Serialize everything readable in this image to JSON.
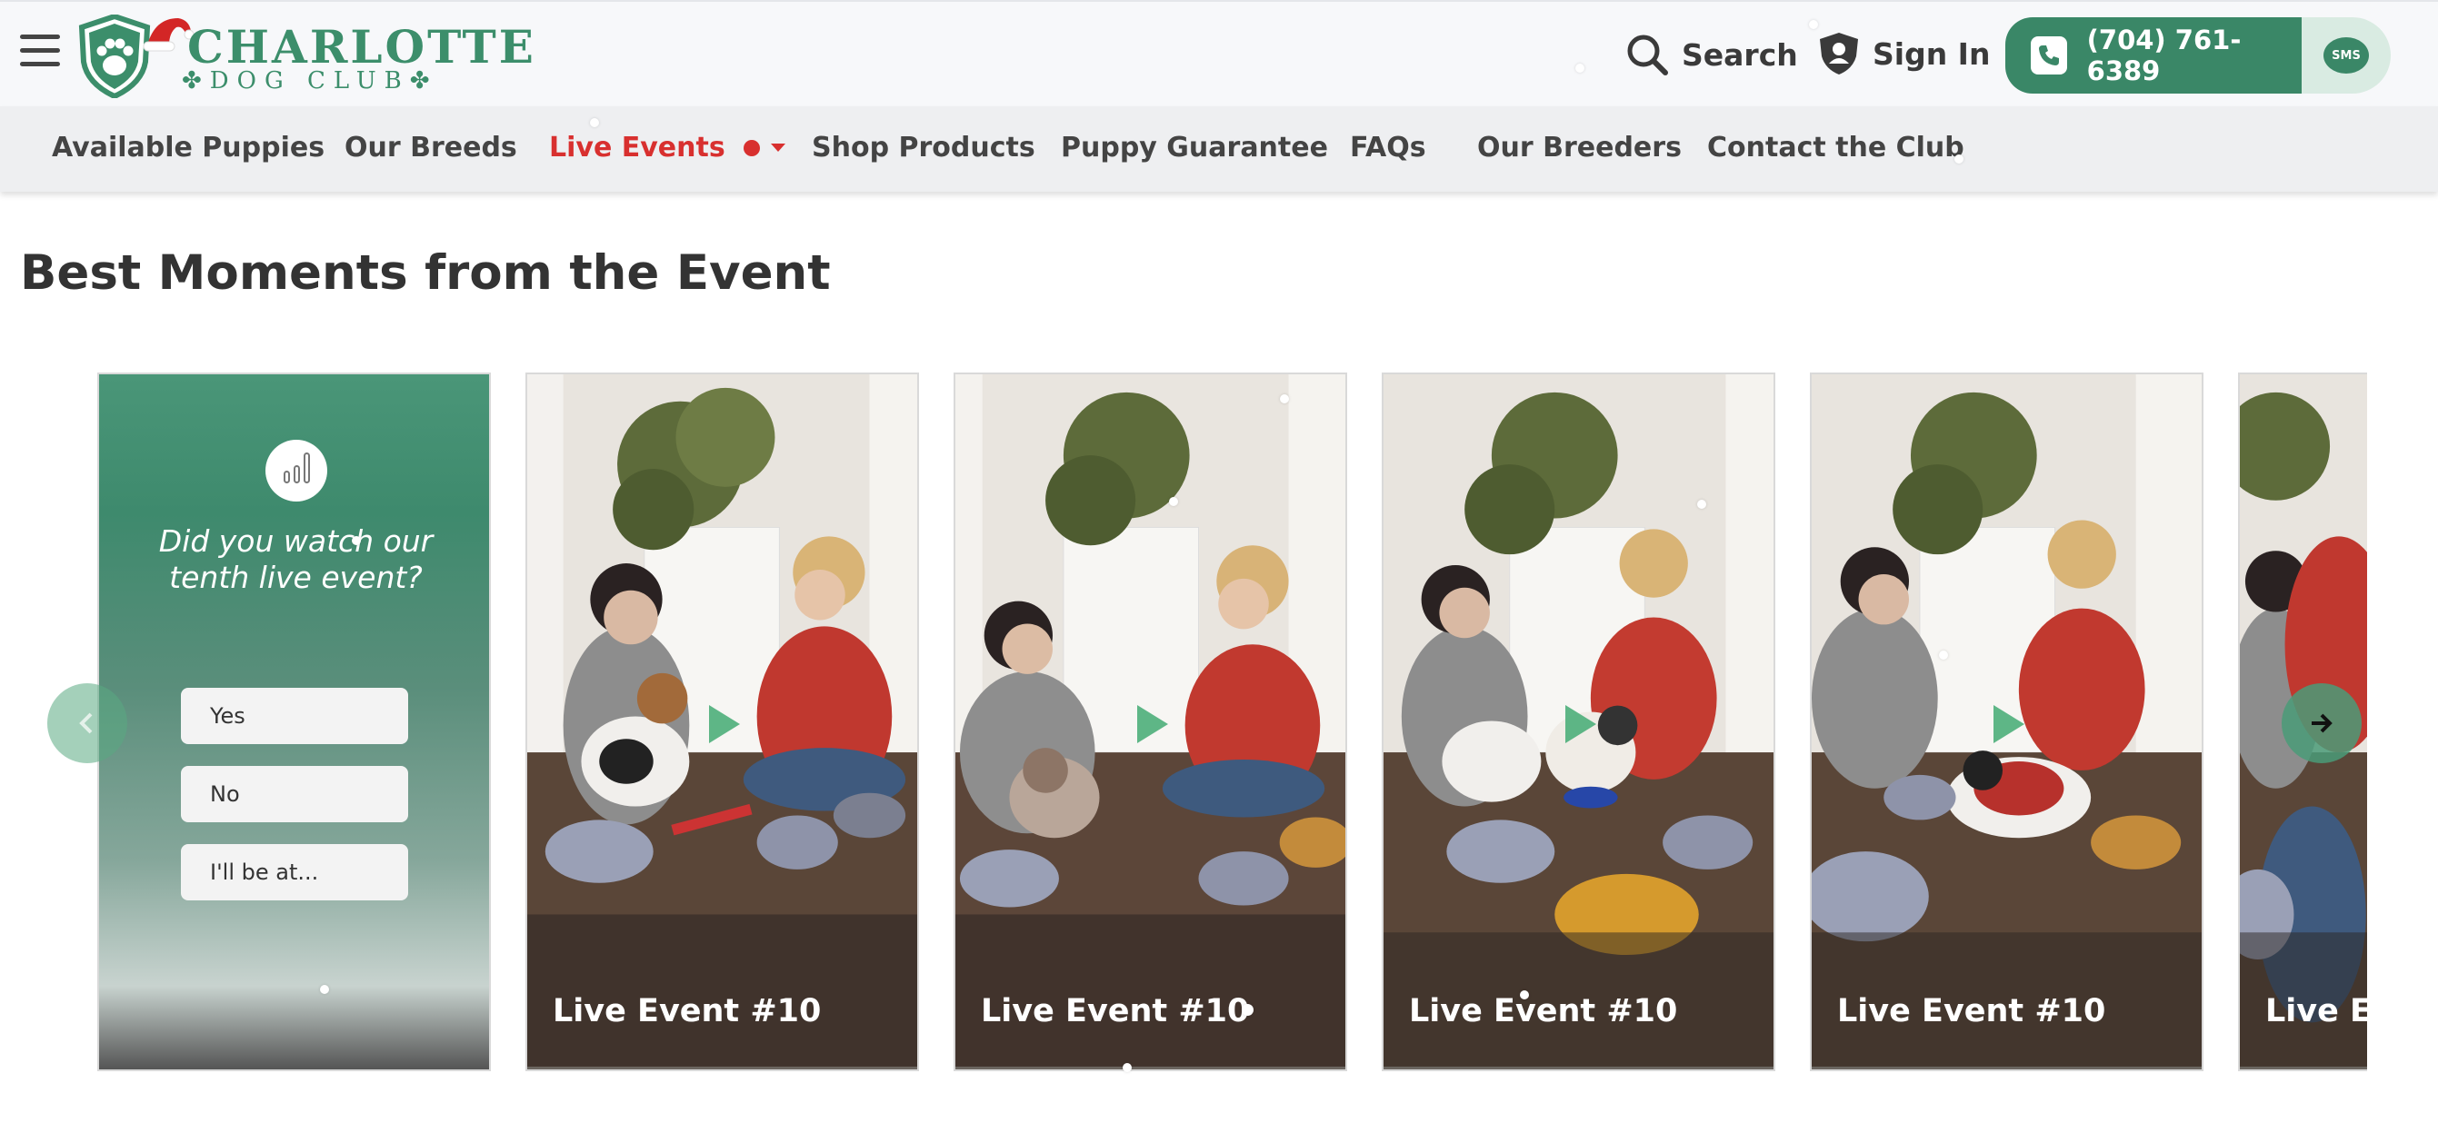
{
  "header": {
    "logo_name": "CHARLOTTE",
    "logo_sub": "✤DOG CLUB✤",
    "search_label": "Search",
    "signin_label": "Sign In",
    "phone": "(704) 761-6389",
    "sms_label": "SMS"
  },
  "nav": {
    "items": [
      "Available Puppies",
      "Our Breeds",
      "Live Events",
      "Shop Products",
      "Puppy Guarantee",
      "FAQs",
      "Our Breeders",
      "Contact the Club"
    ],
    "active": "Live Events"
  },
  "section": {
    "title": "Best Moments from the Event"
  },
  "poll": {
    "question": "Did you watch our tenth live event?",
    "options": [
      "Yes",
      "No",
      "I'll be at..."
    ]
  },
  "videos": [
    {
      "label": "Live Event #10"
    },
    {
      "label": "Live Event #10"
    },
    {
      "label": "Live Event #10"
    },
    {
      "label": "Live Event #10"
    },
    {
      "label": "Live Ev"
    }
  ],
  "colors": {
    "brand_green": "#3a8767",
    "active_red": "#d8302f",
    "nav_bg": "#eeeff1"
  }
}
